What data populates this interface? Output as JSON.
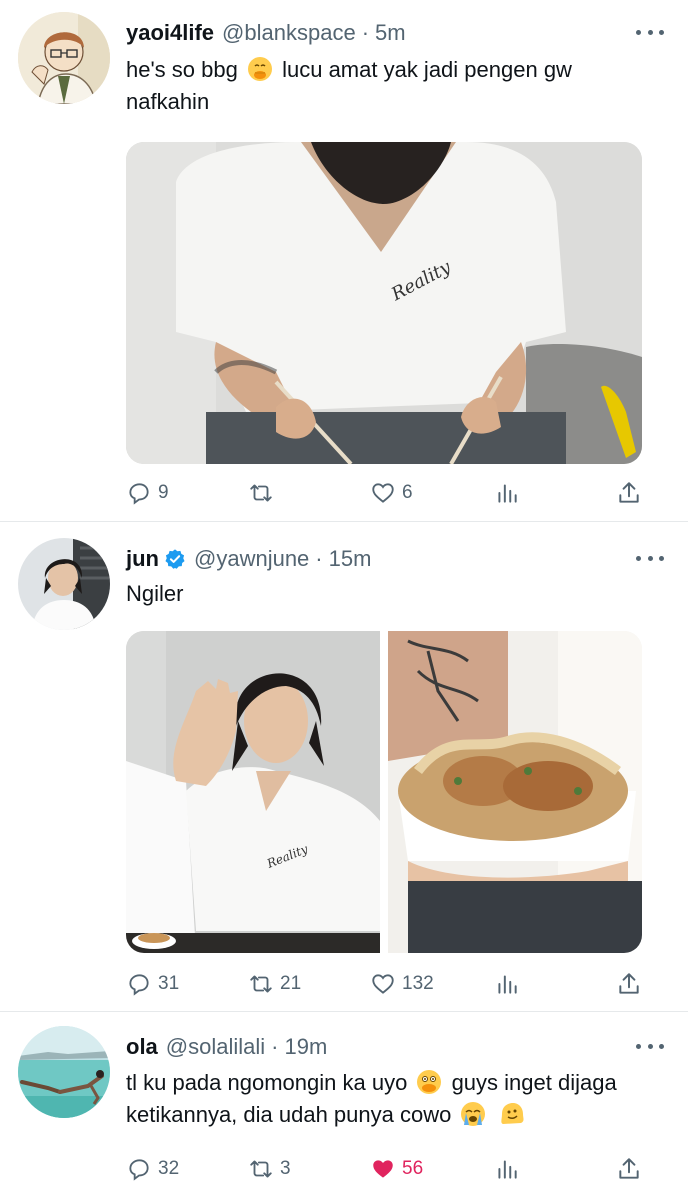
{
  "tweets": [
    {
      "name": "yaoi4life",
      "handle": "@blankspace",
      "time": "5m",
      "text_parts": [
        "he's so bbg",
        "lucu amat yak jadi pengen gw nafkahin"
      ],
      "emojis": [
        "hand-over-mouth-emoji"
      ],
      "replies": "9",
      "retweets": "",
      "likes": "6",
      "liked": false
    },
    {
      "name": "jun",
      "handle": "@yawnjune",
      "time": "15m",
      "verified": true,
      "text": "Ngiler",
      "replies": "31",
      "retweets": "21",
      "likes": "132",
      "liked": false
    },
    {
      "name": "ola",
      "handle": "@solalilali",
      "time": "19m",
      "text_parts": [
        "tl ku pada ngomongin ka uyo",
        "guys inget dijaga ketikannya, dia udah punya cowo"
      ],
      "emojis": [
        "face-with-open-eyes-and-hand-over-mouth-emoji",
        "loudly-crying-face-emoji",
        "melting-face-emoji"
      ],
      "replies": "32",
      "retweets": "3",
      "likes": "56",
      "liked": true
    }
  ],
  "colors": {
    "secondary_text": "#536471",
    "like_active": "#e0245e",
    "verified_badge": "#1d9bf0",
    "divider": "#e6e9eb"
  }
}
